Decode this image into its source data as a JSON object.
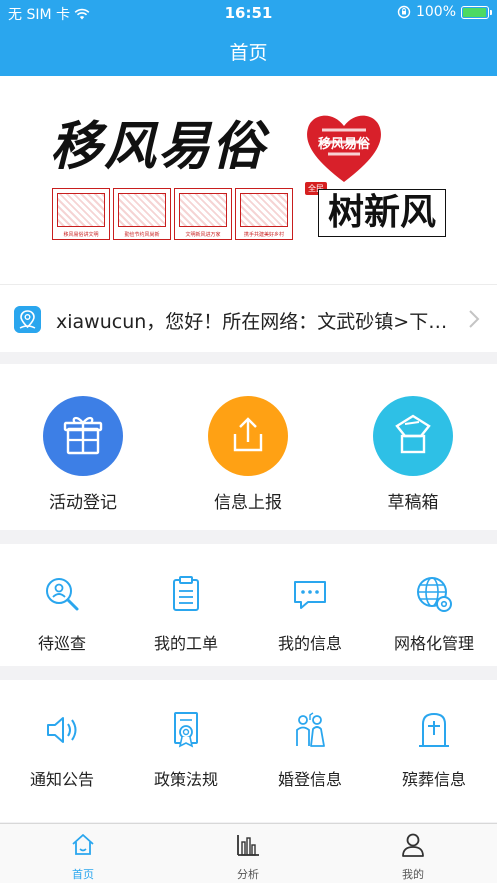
{
  "status_bar": {
    "carrier": "无 SIM 卡",
    "time": "16:51",
    "battery_text": "100%",
    "battery_level": 1.0
  },
  "nav": {
    "title": "首页"
  },
  "banner": {
    "title": "移风易俗",
    "subtitle": "树新风",
    "stamp": "全民",
    "heart_text": "移风易俗",
    "papercut_captions": [
      "移风易俗讲文明",
      "勤俭节约风尚新",
      "文明新风进万家",
      "携手共建美好乡村"
    ]
  },
  "welcome": {
    "text": "xiawucun，您好！所在网络：文武砂镇>下…",
    "icon": "location-people-icon"
  },
  "quick_actions": [
    {
      "label": "活动登记",
      "icon": "gift-icon",
      "color": "#3d7fe6"
    },
    {
      "label": "信息上报",
      "icon": "upload-icon",
      "color": "#ffa114"
    },
    {
      "label": "草稿箱",
      "icon": "draft-box-icon",
      "color": "#2ec0e6"
    }
  ],
  "grid_row1": [
    {
      "label": "待巡查",
      "icon": "patrol-search-icon"
    },
    {
      "label": "我的工单",
      "icon": "clipboard-icon"
    },
    {
      "label": "我的信息",
      "icon": "message-bubble-icon"
    },
    {
      "label": "网格化管理",
      "icon": "globe-gear-icon"
    }
  ],
  "grid_row2": [
    {
      "label": "通知公告",
      "icon": "speaker-icon"
    },
    {
      "label": "政策法规",
      "icon": "certificate-icon"
    },
    {
      "label": "婚登信息",
      "icon": "wedding-couple-icon"
    },
    {
      "label": "殡葬信息",
      "icon": "tombstone-icon"
    }
  ],
  "tab_bar": [
    {
      "label": "首页",
      "icon": "home-icon",
      "active": true
    },
    {
      "label": "分析",
      "icon": "bar-chart-icon",
      "active": false
    },
    {
      "label": "我的",
      "icon": "user-icon",
      "active": false
    }
  ],
  "colors": {
    "primary": "#2aa6ee",
    "banner_red": "#c81e1e",
    "line_icon": "#2aa6ee"
  }
}
